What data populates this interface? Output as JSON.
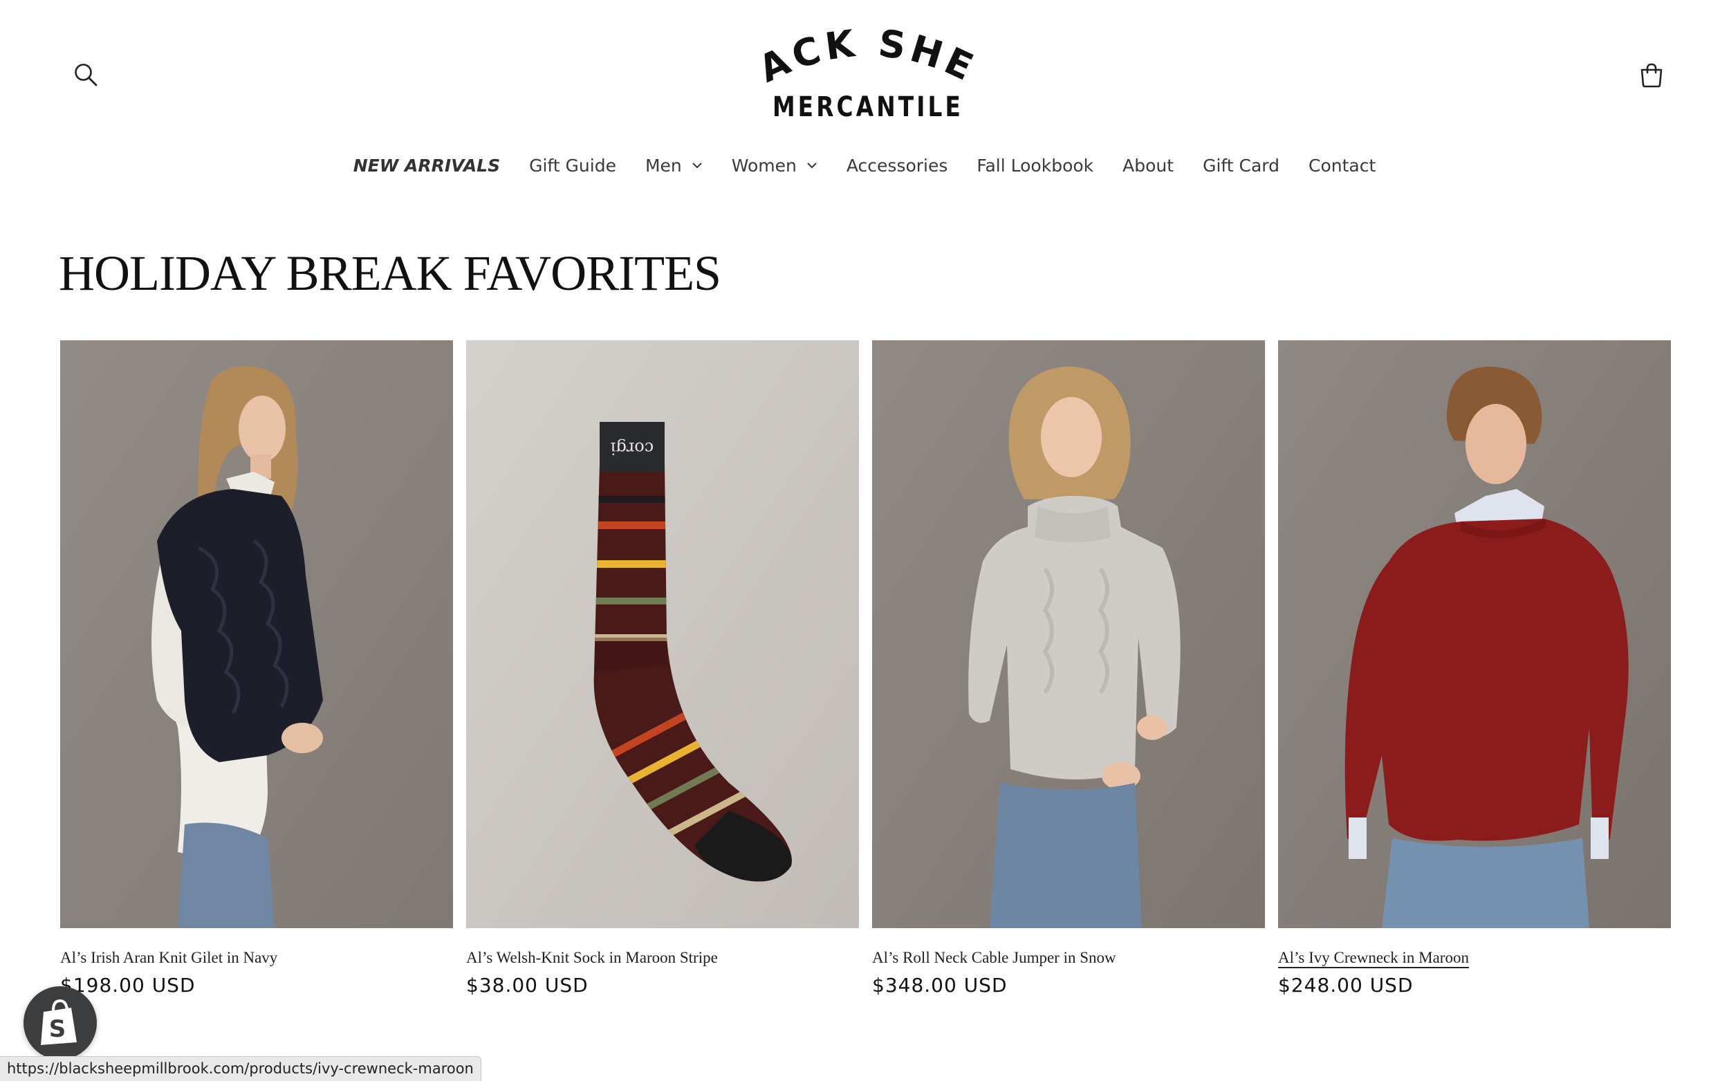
{
  "header": {
    "logo_line1": "BLACK SHEEP",
    "logo_line2": "MERCANTILE",
    "search_icon": "search-icon",
    "cart_icon": "cart-icon"
  },
  "nav": {
    "items": [
      {
        "label": "NEW ARRIVALS",
        "dropdown": false
      },
      {
        "label": "Gift Guide",
        "dropdown": false
      },
      {
        "label": "Men",
        "dropdown": true
      },
      {
        "label": "Women",
        "dropdown": true
      },
      {
        "label": "Accessories",
        "dropdown": false
      },
      {
        "label": "Fall Lookbook",
        "dropdown": false
      },
      {
        "label": "About",
        "dropdown": false
      },
      {
        "label": "Gift Card",
        "dropdown": false
      },
      {
        "label": "Contact",
        "dropdown": false
      }
    ]
  },
  "collection": {
    "title": "HOLIDAY BREAK FAVORITES",
    "products": [
      {
        "name": "Al’s Irish Aran Knit Gilet in Navy",
        "price": "$198.00 USD",
        "image": "woman-navy-knit-gilet-photo"
      },
      {
        "name": "Al’s Welsh-Knit Sock in Maroon Stripe",
        "price": "$38.00 USD",
        "image": "maroon-striped-sock-photo"
      },
      {
        "name": "Al’s Roll Neck Cable Jumper in Snow",
        "price": "$348.00 USD",
        "image": "woman-snow-roll-neck-jumper-photo"
      },
      {
        "name": "Al’s Ivy Crewneck in Maroon",
        "price": "$248.00 USD",
        "image": "man-maroon-crewneck-photo"
      }
    ]
  },
  "status_bar": {
    "url": "https://blacksheepmillbrook.com/products/ivy-crewneck-maroon"
  },
  "colors": {
    "text": "#121212",
    "photo_background": "#8f8882",
    "sock_maroon": "#4a1a18",
    "sweater_maroon": "#8c1c1c",
    "shopify_badge": "#3c3d3f"
  }
}
